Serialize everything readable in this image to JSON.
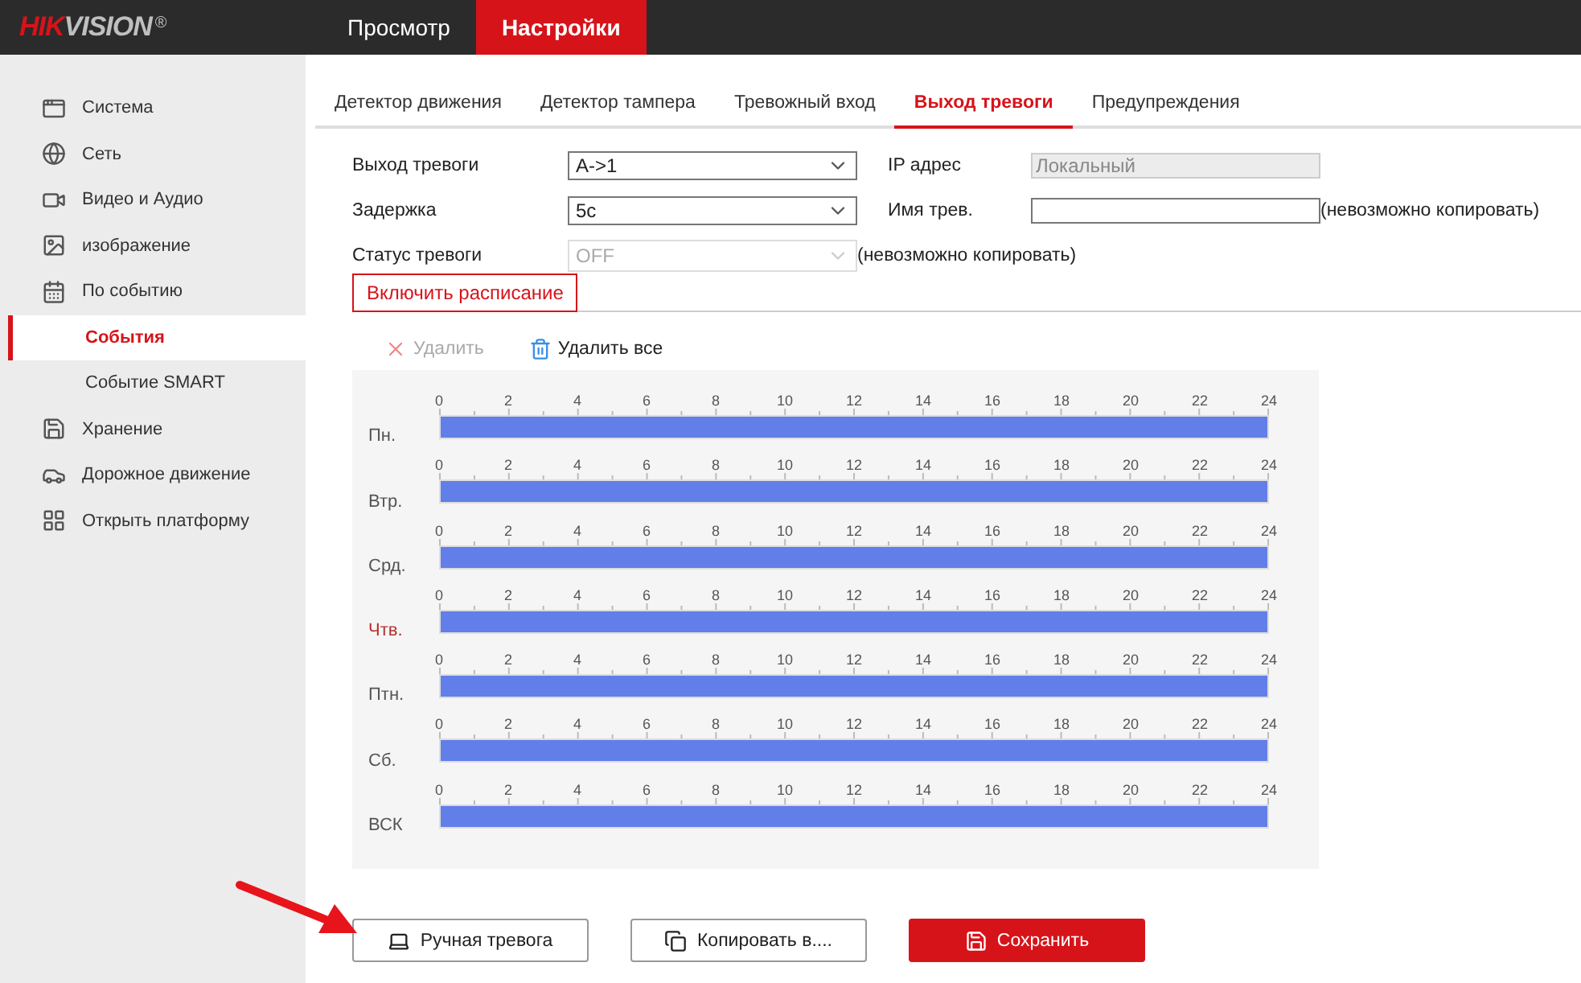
{
  "header": {
    "logo": {
      "accent": "HIK",
      "rest": "VISION",
      "mark": "®"
    },
    "nav": [
      {
        "label": "Просмотр",
        "selected": false
      },
      {
        "label": "Настройки",
        "selected": true
      }
    ]
  },
  "sidebar": {
    "items": [
      {
        "label": "Система",
        "kind": "section",
        "selected": false
      },
      {
        "label": "Сеть",
        "kind": "section",
        "selected": false
      },
      {
        "label": "Видео и Аудио",
        "kind": "section",
        "selected": false
      },
      {
        "label": "изображение",
        "kind": "section",
        "selected": false
      },
      {
        "label": "По событию",
        "kind": "section",
        "selected": false
      },
      {
        "label": "События",
        "kind": "subitem",
        "selected": true
      },
      {
        "label": "Событие SMART",
        "kind": "subitem",
        "selected": false
      },
      {
        "label": "Хранение",
        "kind": "section",
        "selected": false
      },
      {
        "label": "Дорожное движение",
        "kind": "section",
        "selected": false
      },
      {
        "label": "Открыть платформу",
        "kind": "section",
        "selected": false
      }
    ]
  },
  "tabs": [
    {
      "label": "Детектор движения",
      "selected": false
    },
    {
      "label": "Детектор тампера",
      "selected": false
    },
    {
      "label": "Тревожный вход",
      "selected": false
    },
    {
      "label": "Выход тревоги",
      "selected": true
    },
    {
      "label": "Предупреждения",
      "selected": false
    }
  ],
  "form": [
    {
      "label": "Выход тревоги",
      "kind": "select",
      "value": "A->1",
      "disabled": false,
      "side": {
        "label": "IP адрес",
        "kind": "text",
        "value": "Локальный",
        "disabled": true
      }
    },
    {
      "label": "Задержка",
      "kind": "select",
      "value": "5с",
      "disabled": false,
      "side": {
        "label": "Имя трев.",
        "kind": "text",
        "disabled": false,
        "note": "(невозможно копировать)"
      }
    },
    {
      "label": "Статус тревоги",
      "kind": "select",
      "value": "OFF",
      "disabled": true,
      "note": "(невозможно копировать)"
    }
  ],
  "schedule_button": "Включить расписание",
  "actions": [
    {
      "label": "Удалить",
      "kind": "delete",
      "disabled": true
    },
    {
      "label": "Удалить все",
      "kind": "delete_all",
      "disabled": false
    }
  ],
  "days": [
    {
      "label": "Пн.",
      "selected": false,
      "level": 1,
      "ticks": [
        "0",
        "2",
        "4",
        "6",
        "8",
        "10",
        "12",
        "14",
        "16",
        "18",
        "20",
        "22",
        "24"
      ]
    },
    {
      "label": "Втр.",
      "selected": false,
      "level": 1,
      "ticks": [
        "0",
        "2",
        "4",
        "6",
        "8",
        "10",
        "12",
        "14",
        "16",
        "18",
        "20",
        "22",
        "24"
      ]
    },
    {
      "label": "Срд.",
      "selected": false,
      "level": 1,
      "ticks": [
        "0",
        "2",
        "4",
        "6",
        "8",
        "10",
        "12",
        "14",
        "16",
        "18",
        "20",
        "22",
        "24"
      ]
    },
    {
      "label": "Чтв.",
      "selected": true,
      "level": 1,
      "ticks": [
        "0",
        "2",
        "4",
        "6",
        "8",
        "10",
        "12",
        "14",
        "16",
        "18",
        "20",
        "22",
        "24"
      ]
    },
    {
      "label": "Птн.",
      "selected": false,
      "level": 1,
      "ticks": [
        "0",
        "2",
        "4",
        "6",
        "8",
        "10",
        "12",
        "14",
        "16",
        "18",
        "20",
        "22",
        "24"
      ]
    },
    {
      "label": "Сб.",
      "selected": false,
      "level": 1,
      "ticks": [
        "0",
        "2",
        "4",
        "6",
        "8",
        "10",
        "12",
        "14",
        "16",
        "18",
        "20",
        "22",
        "24"
      ]
    },
    {
      "label": "ВСК",
      "selected": false,
      "level": 1,
      "ticks": [
        "0",
        "2",
        "4",
        "6",
        "8",
        "10",
        "12",
        "14",
        "16",
        "18",
        "20",
        "22",
        "24"
      ]
    }
  ],
  "buttons": [
    {
      "label": "Ручная тревога",
      "kind": "manual"
    },
    {
      "label": "Копировать в....",
      "kind": "copy"
    },
    {
      "label": "Сохранить",
      "kind": "save"
    }
  ]
}
